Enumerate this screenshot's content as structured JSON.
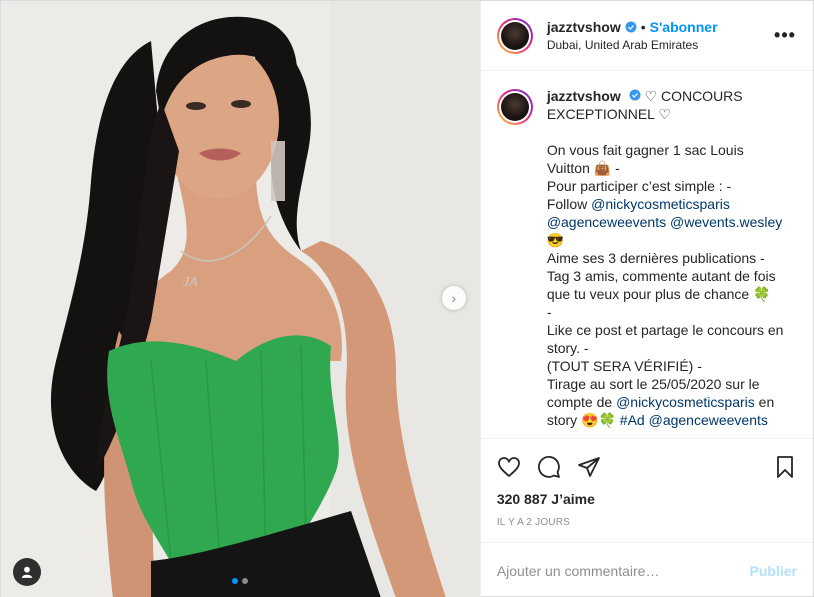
{
  "post": {
    "username": "jazztvshow",
    "separator": "•",
    "follow_label": "S'abonner",
    "location": "Dubai, United Arab Emirates",
    "more_label": "•••",
    "caption": {
      "first_line_text": " CONCOURS",
      "second_line": "EXCEPTIONNEL",
      "lines": [
        {
          "t": "On vous fait gagner 1 sac Louis"
        },
        {
          "t": "Vuitton 👜 -"
        },
        {
          "t": "Pour participer c’est simple : -"
        },
        {
          "t": "Follow ",
          "m": "@nickycosmeticsparis"
        },
        {
          "m": "@agenceweevents",
          "t2": " ",
          "m2": "@wevents.wesley"
        },
        {
          "t": "😎"
        },
        {
          "t": "Aime ses 3 dernières publications -"
        },
        {
          "t": "Tag 3 amis, commente autant de fois"
        },
        {
          "t": "que tu veux pour plus de chance 🍀"
        },
        {
          "t": "-"
        },
        {
          "t": "Like ce post et partage le concours en"
        },
        {
          "t": "story. -"
        },
        {
          "t": "(TOUT SERA VÉRIFIÉ) -"
        },
        {
          "t": "Tirage au sort le 25/05/2020 sur le"
        },
        {
          "t": "compte de ",
          "m": "@nickycosmeticsparis",
          "t2": " en"
        },
        {
          "t": "story 😍🍀 ",
          "m": "#Ad",
          "t2": " ",
          "m2": "@agenceweevents"
        }
      ]
    },
    "likes": "320 887 J’aime",
    "date": "IL Y A 2 JOURS",
    "comment_placeholder": "Ajouter un commentaire…",
    "publish_label": "Publier",
    "next_arrow": "›",
    "carousel": {
      "count": 2,
      "active": 0
    }
  },
  "colors": {
    "link": "#0095f6",
    "mention": "#00376b",
    "top_green": "#2fa84f",
    "verified": "#3897f0"
  },
  "icons": [
    "verified-icon",
    "heart-icon",
    "comment-icon",
    "share-icon",
    "bookmark-icon",
    "user-tag-icon",
    "chevron-right-icon"
  ]
}
